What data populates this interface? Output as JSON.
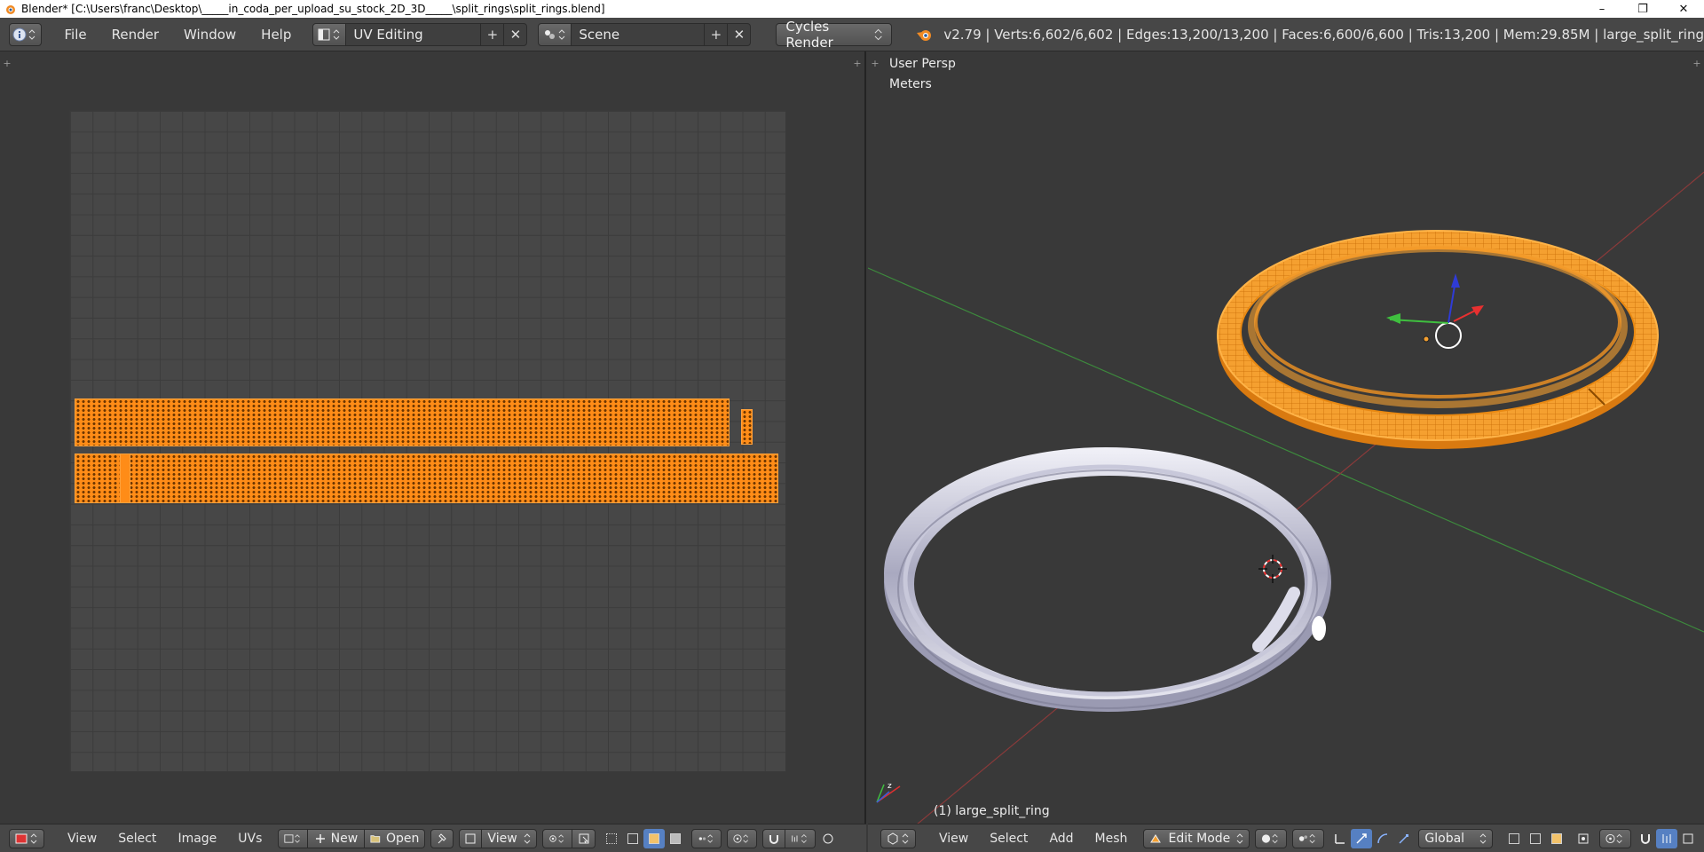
{
  "window": {
    "title": "Blender* [C:\\Users\\franc\\Desktop\\_____in_coda_per_upload_su_stock_2D_3D_____\\split_rings\\split_rings.blend]",
    "minimize": "–",
    "maximize": "❐",
    "close": "✕"
  },
  "info_header": {
    "menus": [
      "File",
      "Render",
      "Window",
      "Help"
    ],
    "screen_layout": "UV Editing",
    "scene": "Scene",
    "add_symbol": "+",
    "remove_symbol": "✕",
    "render_engine": "Cycles Render",
    "stats": "v2.79 | Verts:6,602/6,602 | Edges:13,200/13,200 | Faces:6,600/6,600 | Tris:13,200 | Mem:29.85M | large_split_ring"
  },
  "viewport": {
    "view_name": "User Persp",
    "units": "Meters",
    "object_label": "(1) large_split_ring"
  },
  "uv_bottom": {
    "menus": [
      "View",
      "Select",
      "Image",
      "UVs"
    ],
    "new_label": "New",
    "open_label": "Open",
    "view_label": "View"
  },
  "view3d_bottom": {
    "menus": [
      "View",
      "Select",
      "Add",
      "Mesh"
    ],
    "mode": "Edit Mode",
    "orientation": "Global"
  },
  "colors": {
    "selection_orange": "#ff8c17",
    "background": "#393939",
    "header": "#474747",
    "x_axis": "#c23a3a",
    "y_axis": "#3fa63f",
    "z_axis": "#2f3bd6"
  }
}
